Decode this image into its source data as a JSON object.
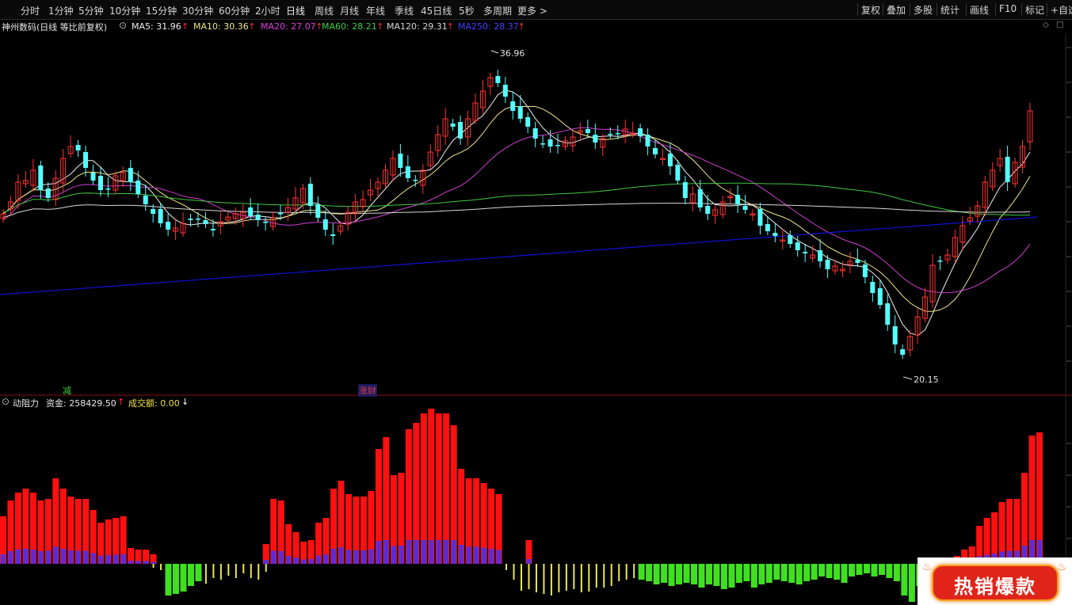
{
  "toolbar": {
    "periods": [
      "分时",
      "1分钟",
      "5分钟",
      "10分钟",
      "15分钟",
      "30分钟",
      "60分钟",
      "2小时",
      "日线",
      "周线",
      "月线",
      "年线",
      "季线",
      "45日线",
      "5秒",
      "多周期",
      "更多 >"
    ],
    "active_period": "日线",
    "right_buttons": [
      "复权",
      "叠加",
      "多股",
      "统计",
      "画线",
      "F10",
      "标记",
      "+自选"
    ]
  },
  "main_panel": {
    "title": "神州数码(日线 等比前复权)",
    "expand_icon": "chevron-circle-icon",
    "ma": [
      {
        "label": "MA5: 31.96",
        "color": "#f0f0f0",
        "arrow": "↑"
      },
      {
        "label": "MA10: 30.36",
        "color": "#f0e68c",
        "arrow": "↑"
      },
      {
        "label": "MA20: 27.07",
        "color": "#e040e0",
        "arrow": "↑"
      },
      {
        "label": "MA60: 28.21",
        "color": "#40d040",
        "arrow": "↑"
      },
      {
        "label": "MA120: 29.31",
        "color": "#d8d8d8",
        "arrow": "↑"
      },
      {
        "label": "MA250: 28.37",
        "color": "#4040ff",
        "arrow": "↑"
      }
    ],
    "arrow_color": "#ff3030",
    "high_label": "36.96",
    "low_label": "20.15",
    "signal_reduce": "减",
    "signal_event": "涨财",
    "corner_icons": [
      "diamond-icon",
      "square-icon"
    ]
  },
  "sub_panel": {
    "title": "动阻力",
    "fund_label": "资金: 258429.50",
    "fund_arrow": "↑",
    "volume_label": "成交额: 0.00",
    "volume_arrow": "↓"
  },
  "badge": {
    "text": "热销爆款"
  },
  "colors": {
    "up": "#ff3232",
    "down": "#54ffff",
    "bar_red": "#ff1010",
    "bar_blue": "#5a2cd8",
    "bar_yellow": "#e8e850",
    "bar_green": "#40e020",
    "ma250": "#1010d8"
  }
}
